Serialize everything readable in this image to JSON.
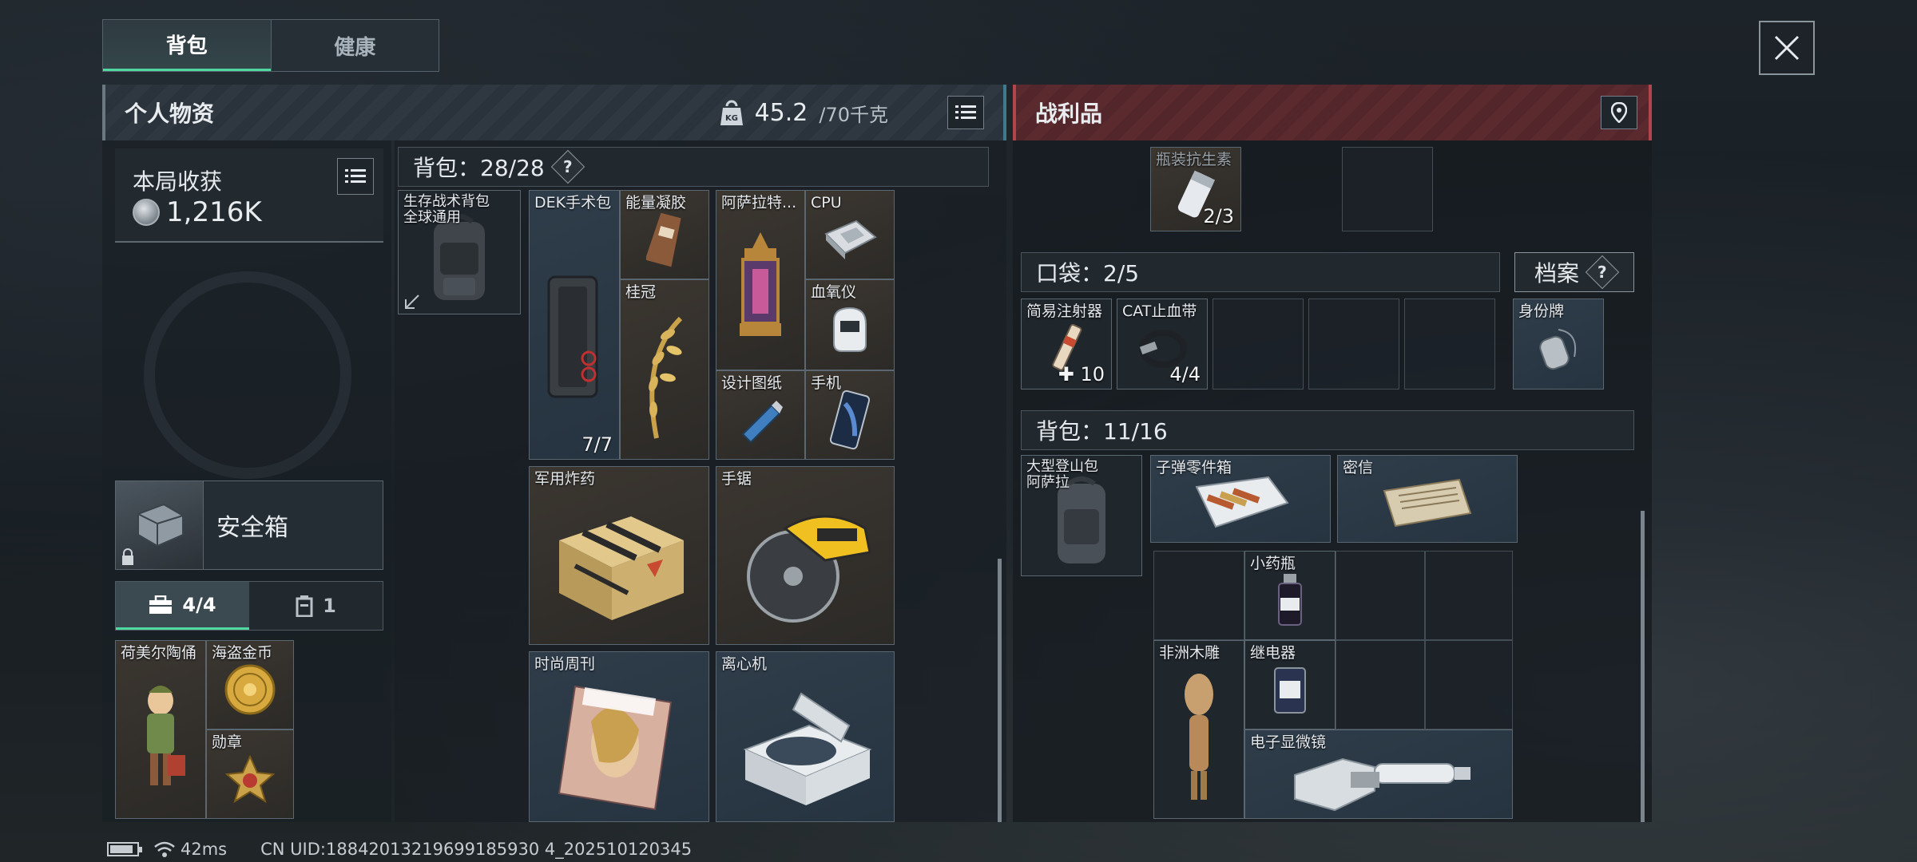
{
  "tabs": [
    {
      "label": "背包",
      "active": true
    },
    {
      "label": "健康",
      "active": false
    }
  ],
  "personal": {
    "title": "个人物资",
    "weight_current": "45.2",
    "weight_max": "/70千克"
  },
  "loot_panel": {
    "title": "战利品"
  },
  "session": {
    "title": "本局收获",
    "value": "1,216K"
  },
  "safebox": {
    "label": "安全箱"
  },
  "subtabs": [
    {
      "label": "4/4",
      "icon": "briefcase-icon",
      "active": true
    },
    {
      "label": "1",
      "icon": "case-icon",
      "active": false
    }
  ],
  "left_items": {
    "item1": "荷美尔陶俑",
    "item2": "海盗金币",
    "item3": "勋章"
  },
  "mid_backpack": {
    "label": "背包：28/28",
    "help": "?",
    "items": {
      "bag": "生存战术背包\n全球通用",
      "dek": "DEK手术包",
      "dek_count": "7/7",
      "energy": "能量凝胶",
      "laurel": "桂冠",
      "lantern": "阿萨拉特...",
      "cpu": "CPU",
      "oximeter": "血氧仪",
      "blueprint": "设计图纸",
      "phone": "手机",
      "explosive": "军用炸药",
      "saw": "手锯",
      "magazine": "时尚周刊",
      "centrifuge": "离心机"
    }
  },
  "right_top": {
    "antibiotic": "瓶装抗生素",
    "antibiotic_count": "2/3"
  },
  "pocket": {
    "label": "口袋：2/5",
    "syringe": "简易注射器",
    "syringe_count": "10",
    "tourniquet": "CAT止血带",
    "tourniquet_count": "4/4"
  },
  "archive": {
    "label": "档案",
    "help": "?",
    "dogtag": "身份牌"
  },
  "loot_backpack": {
    "label": "背包：11/16",
    "bag": "大型登山包\n阿萨拉",
    "ammo": "子弹零件箱",
    "letter": "密信",
    "vial": "小药瓶",
    "statue": "非洲木雕",
    "relay": "继电器",
    "microscope": "电子显微镜"
  },
  "status": {
    "ping": "42ms",
    "uid": "CN UID:18842013219699185930 4_202510120345"
  }
}
